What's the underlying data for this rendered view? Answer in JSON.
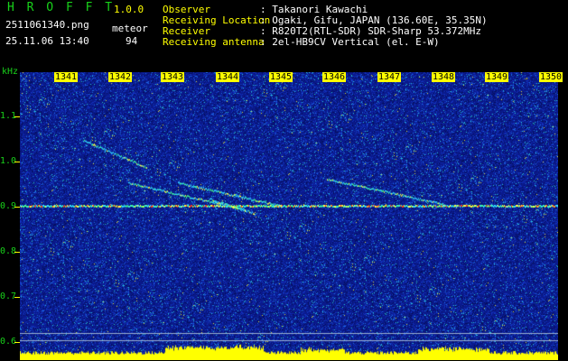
{
  "app": {
    "title_letters": "H R O F F T",
    "version": "1.0.0",
    "filename": "2511061340.png",
    "timestamp": "25.11.06 13:40",
    "count_label": "meteor",
    "count_value": "94"
  },
  "info": {
    "observer_label": "Observer",
    "observer_value": ": Takanori Kawachi",
    "location_label": "Receiving Location",
    "location_value": ": Ogaki, Gifu, JAPAN (136.60E, 35.35N)",
    "receiver_label": "Receiver",
    "receiver_value": ": R820T2(RTL-SDR) SDR-Sharp 53.372MHz",
    "antenna_label": "Receiving antenna",
    "antenna_value": ": 2el-HB9CV Vertical (el. E-W)"
  },
  "axis": {
    "y_unit": "kHz",
    "y_ticks": [
      "1.1",
      "1.0",
      "0.9",
      "0.8",
      "0.7",
      "0.6"
    ],
    "x_ticks": [
      "1341",
      "1342",
      "1343",
      "1344",
      "1345",
      "1346",
      "1347",
      "1348",
      "1349",
      "1350"
    ]
  },
  "colors": {
    "label_green": "#18d11a",
    "tick_yellow": "#ffff00",
    "background_blue": "#0a1a8c"
  }
}
